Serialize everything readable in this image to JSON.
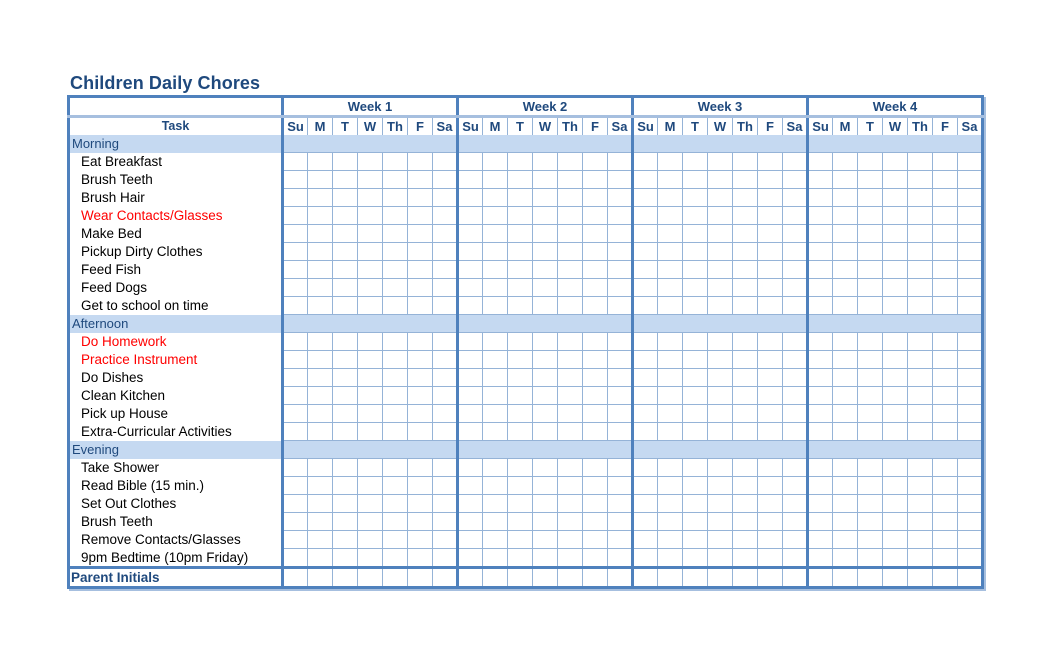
{
  "title": "Children Daily Chores",
  "header": {
    "task_label": "Task",
    "weeks": [
      "Week 1",
      "Week 2",
      "Week 3",
      "Week 4"
    ],
    "days": [
      "Su",
      "M",
      "T",
      "W",
      "Th",
      "F",
      "Sa"
    ]
  },
  "sections": [
    {
      "name": "Morning",
      "tasks": [
        {
          "label": "Eat Breakfast",
          "highlight": false
        },
        {
          "label": "Brush Teeth",
          "highlight": false
        },
        {
          "label": "Brush Hair",
          "highlight": false
        },
        {
          "label": "Wear Contacts/Glasses",
          "highlight": true
        },
        {
          "label": "Make Bed",
          "highlight": false
        },
        {
          "label": "Pickup Dirty Clothes",
          "highlight": false
        },
        {
          "label": "Feed Fish",
          "highlight": false
        },
        {
          "label": "Feed Dogs",
          "highlight": false
        },
        {
          "label": "Get to school on time",
          "highlight": false
        }
      ]
    },
    {
      "name": "Afternoon",
      "tasks": [
        {
          "label": "Do Homework",
          "highlight": true
        },
        {
          "label": "Practice Instrument",
          "highlight": true
        },
        {
          "label": "Do Dishes",
          "highlight": false
        },
        {
          "label": "Clean Kitchen",
          "highlight": false
        },
        {
          "label": "Pick up House",
          "highlight": false
        },
        {
          "label": "Extra-Curricular Activities",
          "highlight": false
        }
      ]
    },
    {
      "name": "Evening",
      "tasks": [
        {
          "label": "Take Shower",
          "highlight": false
        },
        {
          "label": "Read Bible (15 min.)",
          "highlight": false
        },
        {
          "label": "Set Out Clothes",
          "highlight": false
        },
        {
          "label": "Brush Teeth",
          "highlight": false
        },
        {
          "label": "Remove Contacts/Glasses",
          "highlight": false
        },
        {
          "label": "9pm Bedtime (10pm Friday)",
          "highlight": false
        }
      ]
    }
  ],
  "footer": {
    "label": "Parent Initials"
  },
  "colors": {
    "title": "#1f497d",
    "border": "#4f81bd",
    "section_fill": "#c5d9f1",
    "highlight_text": "#ff0000"
  }
}
